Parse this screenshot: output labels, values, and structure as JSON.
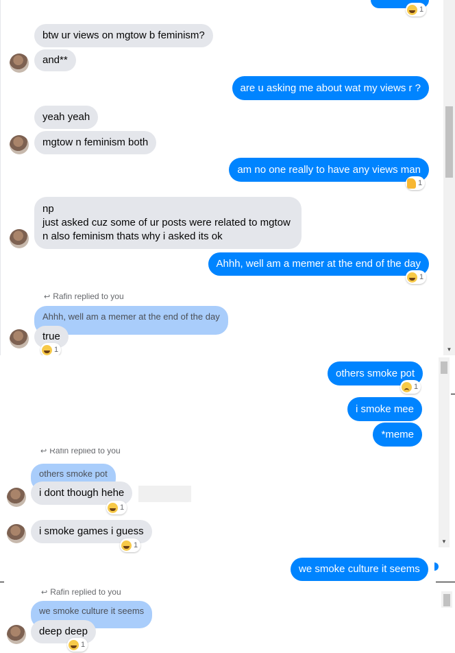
{
  "panel_1": {
    "top_reaction_count": "1",
    "msg1": "btw ur views on mgtow b feminism?",
    "msg2": "and**",
    "msg3": "are u asking me about wat my views r ?",
    "msg4": "yeah yeah",
    "msg5": "mgtow n feminism both",
    "msg6": "am no one really to have any views man",
    "msg6_reaction_count": "1",
    "msg7_line1": "np",
    "msg7_line2": "just asked cuz some of ur posts were related to mgtow",
    "msg7_line3": "n also feminism thats why i asked its ok",
    "msg8": "Ahhh, well am a memer at the end of the day",
    "msg8_reaction_count": "1",
    "reply_label": "Rafin replied to you",
    "quoted": "Ahhh, well am a memer at the end of the day",
    "msg9": "true",
    "msg9_reaction_count": "1"
  },
  "panel_2": {
    "msg1": "others smoke pot",
    "msg1_reaction_count": "1",
    "msg2": "i smoke mee",
    "msg3": "*meme",
    "reply_label": "Rafin replied to you",
    "quoted": "others smoke pot",
    "msg4": "i dont though hehe",
    "msg4_reaction_count": "1",
    "msg5": "i smoke games i guess",
    "msg5_reaction_count": "1"
  },
  "panel_3": {
    "msg1": "we smoke culture it seems",
    "reply_label": "Rafin replied to you",
    "quoted": "we smoke culture it seems",
    "msg2": "deep deep",
    "msg2_reaction_count": "1"
  },
  "colors": {
    "outgoing_bubble": "#0084ff",
    "incoming_bubble": "#e4e6eb",
    "quoted_bubble": "#a9cdfb"
  }
}
